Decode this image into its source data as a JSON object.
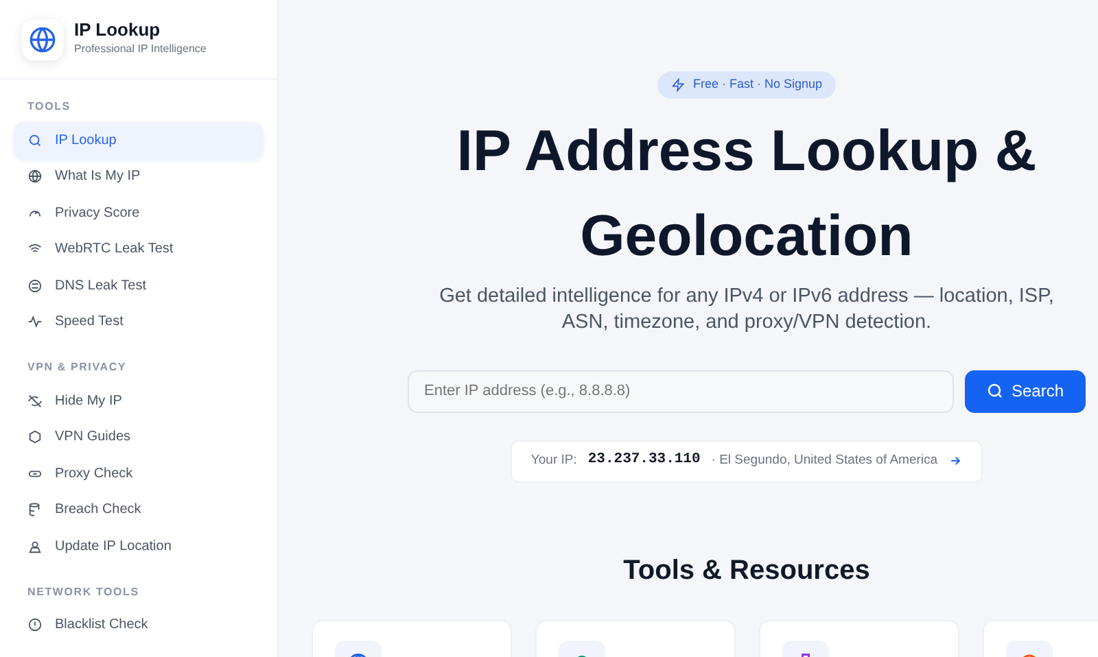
{
  "brand": {
    "title": "IP Lookup",
    "subtitle": "Professional IP Intelligence"
  },
  "sidebar": {
    "sections": [
      {
        "heading": "TOOLS",
        "items": [
          {
            "label": "IP Lookup",
            "selected": true
          },
          {
            "label": "What Is My IP",
            "selected": false
          },
          {
            "label": "Privacy Score",
            "selected": false
          },
          {
            "label": "WebRTC Leak Test",
            "selected": false
          },
          {
            "label": "DNS Leak Test",
            "selected": false
          },
          {
            "label": "Speed Test",
            "selected": false
          }
        ]
      },
      {
        "heading": "VPN & PRIVACY",
        "items": [
          {
            "label": "Hide My IP",
            "selected": false
          },
          {
            "label": "VPN Guides",
            "selected": false
          },
          {
            "label": "Proxy Check",
            "selected": false
          },
          {
            "label": "Breach Check",
            "selected": false
          },
          {
            "label": "Update IP Location",
            "selected": false
          }
        ]
      },
      {
        "heading": "NETWORK TOOLS",
        "items": [
          {
            "label": "Blacklist Check",
            "selected": false
          }
        ]
      }
    ]
  },
  "hero": {
    "badge": "Free · Fast · No Signup",
    "title": "IP Address Lookup & Geolocation",
    "subtitle": "Get detailed intelligence for any IPv4 or IPv6 address — location, ISP, ASN, timezone, and proxy/VPN detection.",
    "search": {
      "placeholder": "Enter IP address (e.g., 8.8.8.8)",
      "button": "Search"
    },
    "your_ip": {
      "label": "Your IP:",
      "ip": "23.237.33.110",
      "location": "· El Segundo, United States of America"
    }
  },
  "resources": {
    "heading": "Tools & Resources",
    "cards": [
      {
        "color": "#2563eb"
      },
      {
        "color": "#059669"
      },
      {
        "color": "#9333ea"
      },
      {
        "color": "#ea580c"
      }
    ]
  }
}
